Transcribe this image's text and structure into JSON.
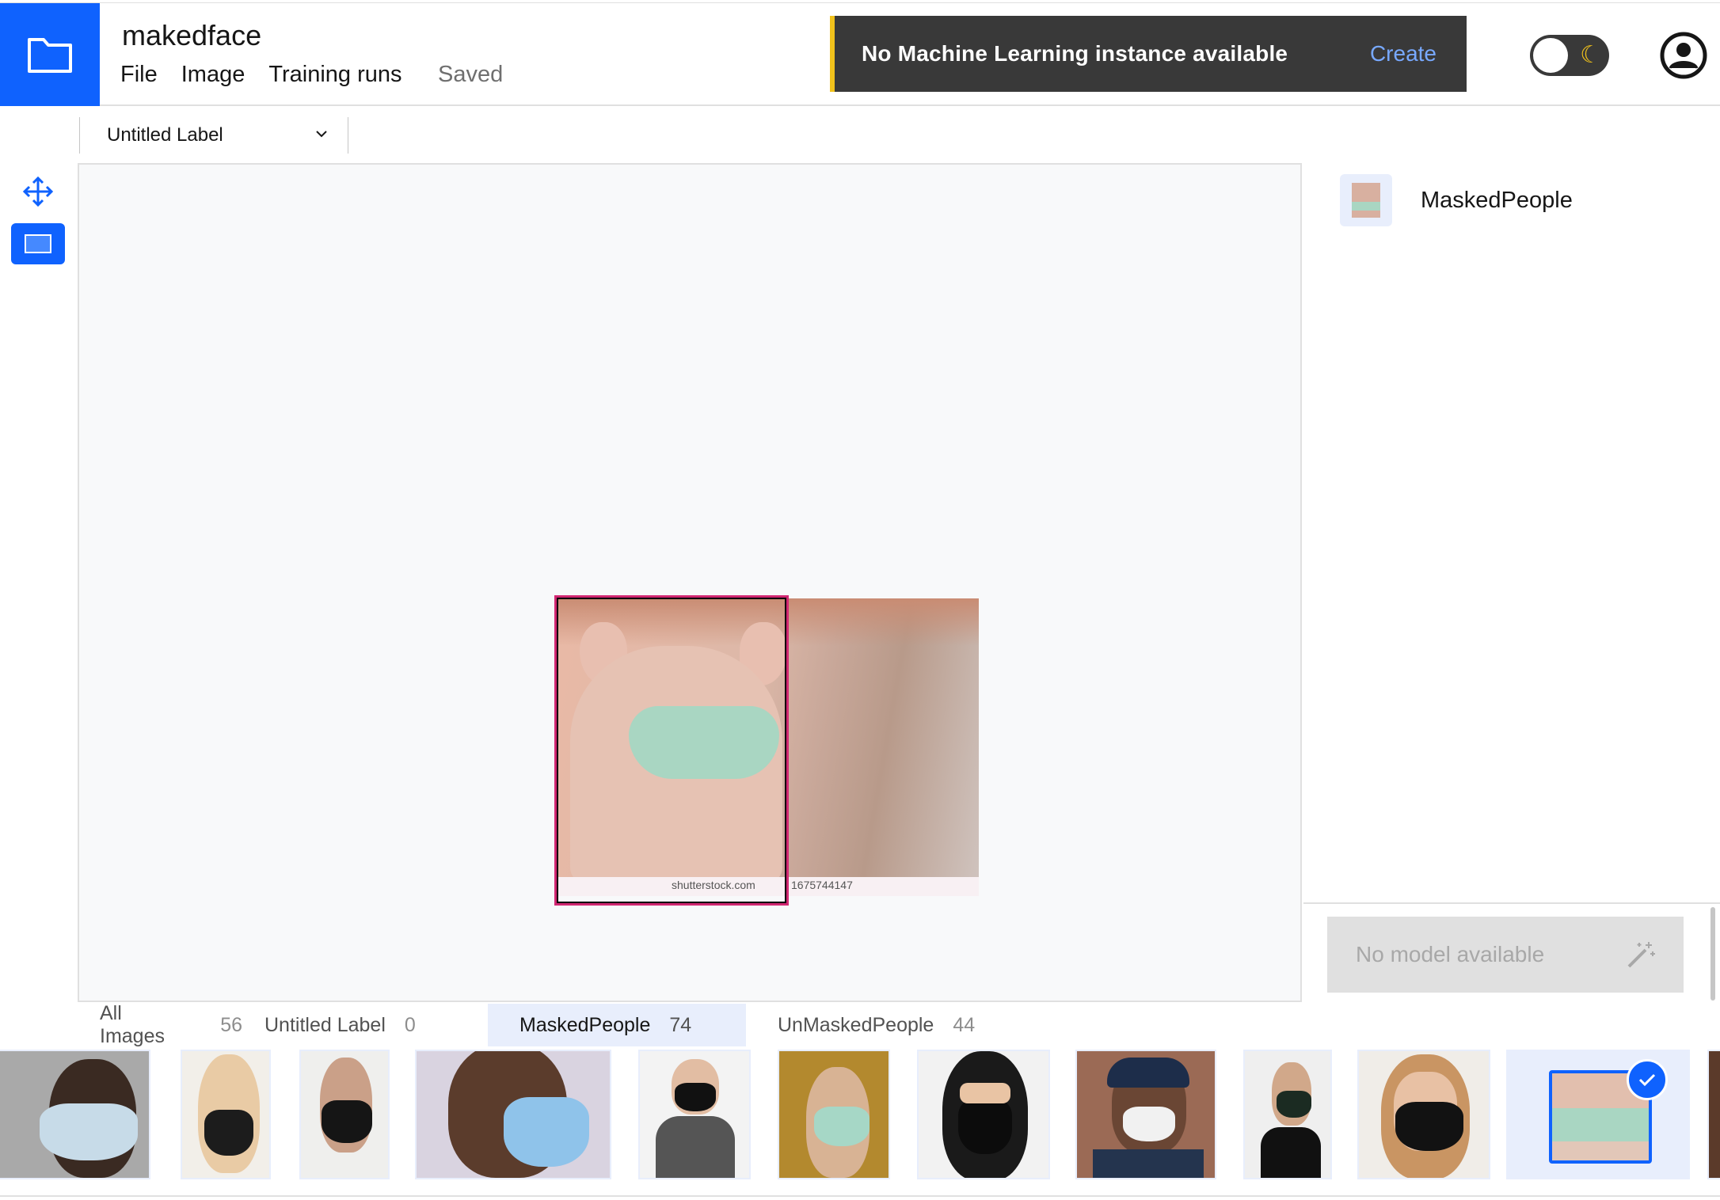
{
  "header": {
    "project_title": "makedface",
    "menu": [
      "File",
      "Image",
      "Training runs"
    ],
    "save_status": "Saved"
  },
  "notification": {
    "message": "No Machine Learning instance available",
    "action": "Create"
  },
  "theme_toggle": {
    "icon": "moon-icon",
    "state": "off"
  },
  "toolbar": {
    "label_select": "Untitled Label"
  },
  "tools": [
    "move-icon",
    "bounding-box-icon"
  ],
  "canvas": {
    "image_watermark": "shutterstock.com",
    "image_number": "1675744147"
  },
  "labels_panel": {
    "labels": [
      {
        "name": "MaskedPeople"
      }
    ]
  },
  "model": {
    "button_text": "No model available",
    "icon": "magic-wand-icon"
  },
  "tabs": [
    {
      "label": "All Images",
      "count": "56"
    },
    {
      "label": "Untitled Label",
      "count": "0"
    },
    {
      "label": "MaskedPeople",
      "count": "74"
    },
    {
      "label": "UnMaskedPeople",
      "count": "44"
    }
  ],
  "colors": {
    "accent": "#0f62fe",
    "notification_bg": "#393939",
    "notification_border": "#f1c21b",
    "bbox": "#d12771",
    "link": "#78a9ff"
  }
}
